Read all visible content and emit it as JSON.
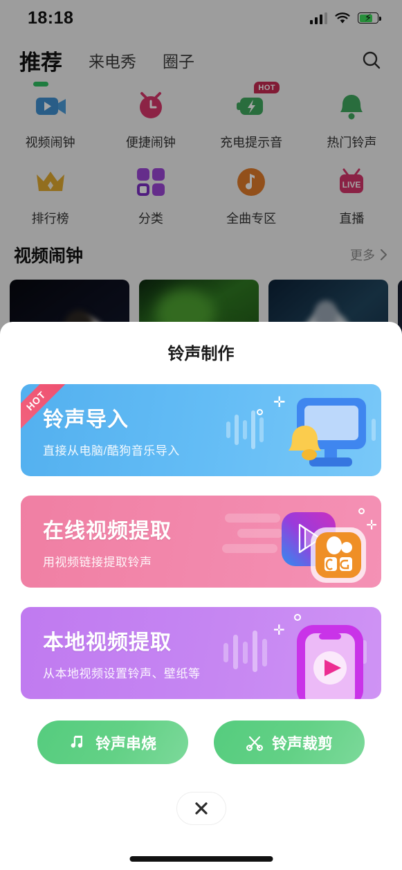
{
  "status_bar": {
    "time": "18:18",
    "cellular_icon": "signal-bars-icon",
    "wifi_icon": "wifi-icon",
    "battery_icon": "battery-charging-icon",
    "battery_color": "#3ddc5b"
  },
  "top_nav": {
    "tabs": [
      {
        "label": "推荐",
        "active": true
      },
      {
        "label": "来电秀",
        "active": false
      },
      {
        "label": "圈子",
        "active": false
      }
    ],
    "indicator_color": "#2fbf62",
    "search_icon": "search-icon"
  },
  "quick_grid": {
    "items": [
      {
        "label": "视频闹钟",
        "icon": "video-camera-icon",
        "color": "#3f8fd0",
        "badge": ""
      },
      {
        "label": "便捷闹钟",
        "icon": "alarm-clock-icon",
        "color": "#d8376b",
        "badge": ""
      },
      {
        "label": "充电提示音",
        "icon": "battery-bolt-icon",
        "color": "#3fa85f",
        "badge": "HOT"
      },
      {
        "label": "热门铃声",
        "icon": "bell-icon",
        "color": "#3fa85f",
        "badge": ""
      },
      {
        "label": "排行榜",
        "icon": "crown-icon",
        "color": "#e0a92e",
        "badge": ""
      },
      {
        "label": "分类",
        "icon": "grid-squares-icon",
        "color": "#9b45d6",
        "badge": ""
      },
      {
        "label": "全曲专区",
        "icon": "music-note-icon",
        "color": "#e07b2a",
        "badge": ""
      },
      {
        "label": "直播",
        "icon": "live-tv-icon",
        "color": "#d4356a",
        "badge": "LIVE"
      }
    ]
  },
  "section": {
    "title": "视频闹钟",
    "more_label": "更多",
    "more_chevron": "chevron-right-icon"
  },
  "video_cards": [
    {
      "name": "video-thumb-1"
    },
    {
      "name": "video-thumb-2"
    },
    {
      "name": "video-thumb-3"
    },
    {
      "name": "video-thumb-4"
    }
  ],
  "sheet": {
    "title": "铃声制作",
    "cards": [
      {
        "id": "card-import",
        "title": "铃声导入",
        "subtitle": "直接从电脑/酷狗音乐导入",
        "ribbon": "HOT",
        "accent": "#53b0ef",
        "illustration": "monitor-bell-icon"
      },
      {
        "id": "card-online",
        "title": "在线视频提取",
        "subtitle": "用视频链接提取铃声",
        "ribbon": "",
        "accent": "#f07fa3",
        "illustration": "video-app-icons"
      },
      {
        "id": "card-local",
        "title": "本地视频提取",
        "subtitle": "从本地视频设置铃声、壁纸等",
        "ribbon": "",
        "accent": "#c07af0",
        "illustration": "phone-play-icon"
      }
    ],
    "actions": [
      {
        "label": "铃声串烧",
        "icon": "double-music-note-icon"
      },
      {
        "label": "铃声裁剪",
        "icon": "scissors-icon"
      }
    ],
    "close_icon": "close-icon",
    "action_color": "#63d186"
  }
}
